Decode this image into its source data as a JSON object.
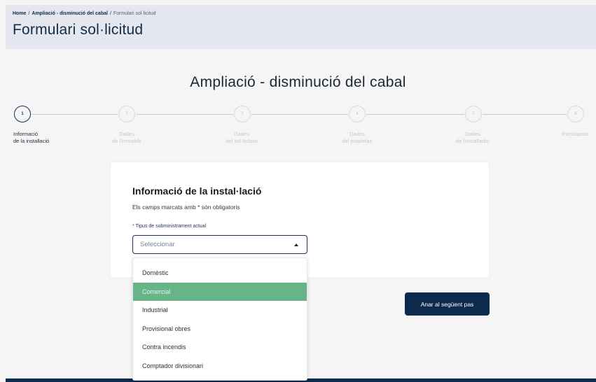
{
  "breadcrumb": {
    "home": "Home",
    "sep1": "/",
    "section": "Ampliació - disminució del cabal",
    "sep2": "/",
    "current": "Formulari sol·licitud"
  },
  "page_title": "Formulari sol·licitud",
  "flow_title": "Ampliació - disminució del cabal",
  "steps": [
    {
      "number": "1",
      "line1": "Informació",
      "line2": "de la installació",
      "active": true
    },
    {
      "number": "2",
      "line1": "Dades",
      "line2": "de l'immoble",
      "active": false
    },
    {
      "number": "3",
      "line1": "Dades",
      "line2": "del sol·licitant",
      "active": false
    },
    {
      "number": "4",
      "line1": "Dades",
      "line2": "del propietari",
      "active": false
    },
    {
      "number": "5",
      "line1": "Dades",
      "line2": "de l'installador",
      "active": false
    },
    {
      "number": "6",
      "line1": "Pressupost",
      "line2": "",
      "active": false
    }
  ],
  "form": {
    "title": "Informació de la instal·lació",
    "subtitle": "Els camps marcats amb * són obligatoris",
    "field_required_mark": "*",
    "field_label": "Tipus de subministrament actual",
    "select_value": "Seleccionar"
  },
  "dropdown": {
    "options": [
      "Domèstic",
      "Comercial",
      "Industrial",
      "Provisional obres",
      "Contra incendis",
      "Comptador divisionari"
    ],
    "highlighted": "Comercial"
  },
  "next_button": "Anar al següent pas",
  "colors": {
    "primary": "#0b2a4d",
    "highlight": "#66b487",
    "header_bg": "#e4e8ee"
  }
}
